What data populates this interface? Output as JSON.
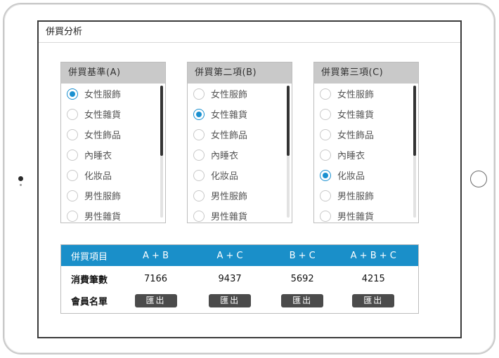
{
  "window": {
    "title": "併買分析"
  },
  "panels": [
    {
      "title": "併買基準(A)",
      "options": [
        {
          "label": "女性服飾",
          "checked": true
        },
        {
          "label": "女性雜貨",
          "checked": false
        },
        {
          "label": "女性飾品",
          "checked": false
        },
        {
          "label": "內睡衣",
          "checked": false
        },
        {
          "label": "化妝品",
          "checked": false
        },
        {
          "label": "男性服飾",
          "checked": false
        },
        {
          "label": "男性雜貨",
          "checked": false
        }
      ]
    },
    {
      "title": "併買第二項(B)",
      "options": [
        {
          "label": "女性服飾",
          "checked": false
        },
        {
          "label": "女性雜貨",
          "checked": true
        },
        {
          "label": "女性飾品",
          "checked": false
        },
        {
          "label": "內睡衣",
          "checked": false
        },
        {
          "label": "化妝品",
          "checked": false
        },
        {
          "label": "男性服飾",
          "checked": false
        },
        {
          "label": "男性雜貨",
          "checked": false
        }
      ]
    },
    {
      "title": "併買第三項(C)",
      "options": [
        {
          "label": "女性服飾",
          "checked": false
        },
        {
          "label": "女性雜貨",
          "checked": false
        },
        {
          "label": "女性飾品",
          "checked": false
        },
        {
          "label": "內睡衣",
          "checked": false
        },
        {
          "label": "化妝品",
          "checked": true
        },
        {
          "label": "男性服飾",
          "checked": false
        },
        {
          "label": "男性雜貨",
          "checked": false
        }
      ]
    }
  ],
  "results": {
    "headers": [
      "併買項目",
      "A + B",
      "A + C",
      "B + C",
      "A + B + C"
    ],
    "count_label": "消費筆數",
    "counts": [
      "7166",
      "9437",
      "5692",
      "4215"
    ],
    "member_label": "會員名單",
    "export_label": "匯出"
  },
  "colors": {
    "accent": "#1a8fc9",
    "radio_checked": "#1a90d0",
    "panel_header": "#c9c9c9",
    "button": "#4b4b4b"
  }
}
